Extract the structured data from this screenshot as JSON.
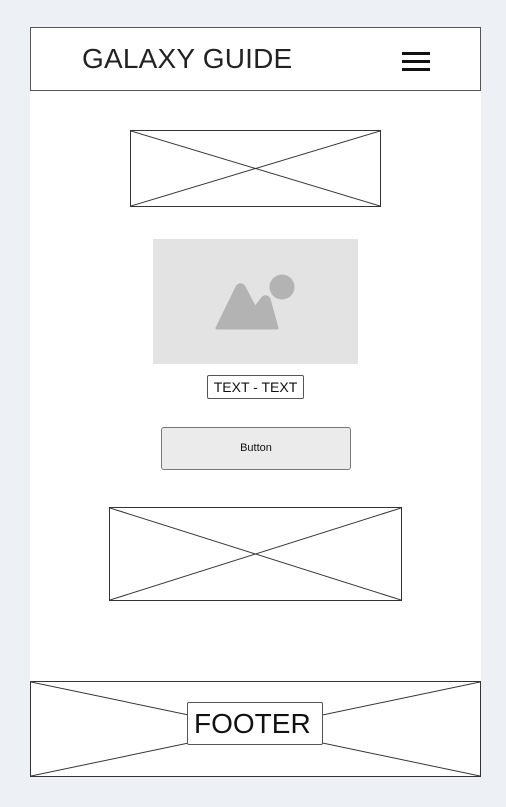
{
  "header": {
    "title": "GALAXY GUIDE",
    "menu_icon": "hamburger-menu-icon"
  },
  "main": {
    "top_placeholder_icon": "placeholder-x-icon",
    "image_icon": "image-placeholder-icon",
    "text_label": "TEXT - TEXT",
    "button_label": "Button",
    "bottom_placeholder_icon": "placeholder-x-icon"
  },
  "footer": {
    "label": "FOOTER"
  },
  "colors": {
    "background": "#edf0f5",
    "page": "#ffffff",
    "image_block": "#e3e3e3",
    "image_glyph": "#b3b3b3",
    "button": "#ebebeb"
  }
}
